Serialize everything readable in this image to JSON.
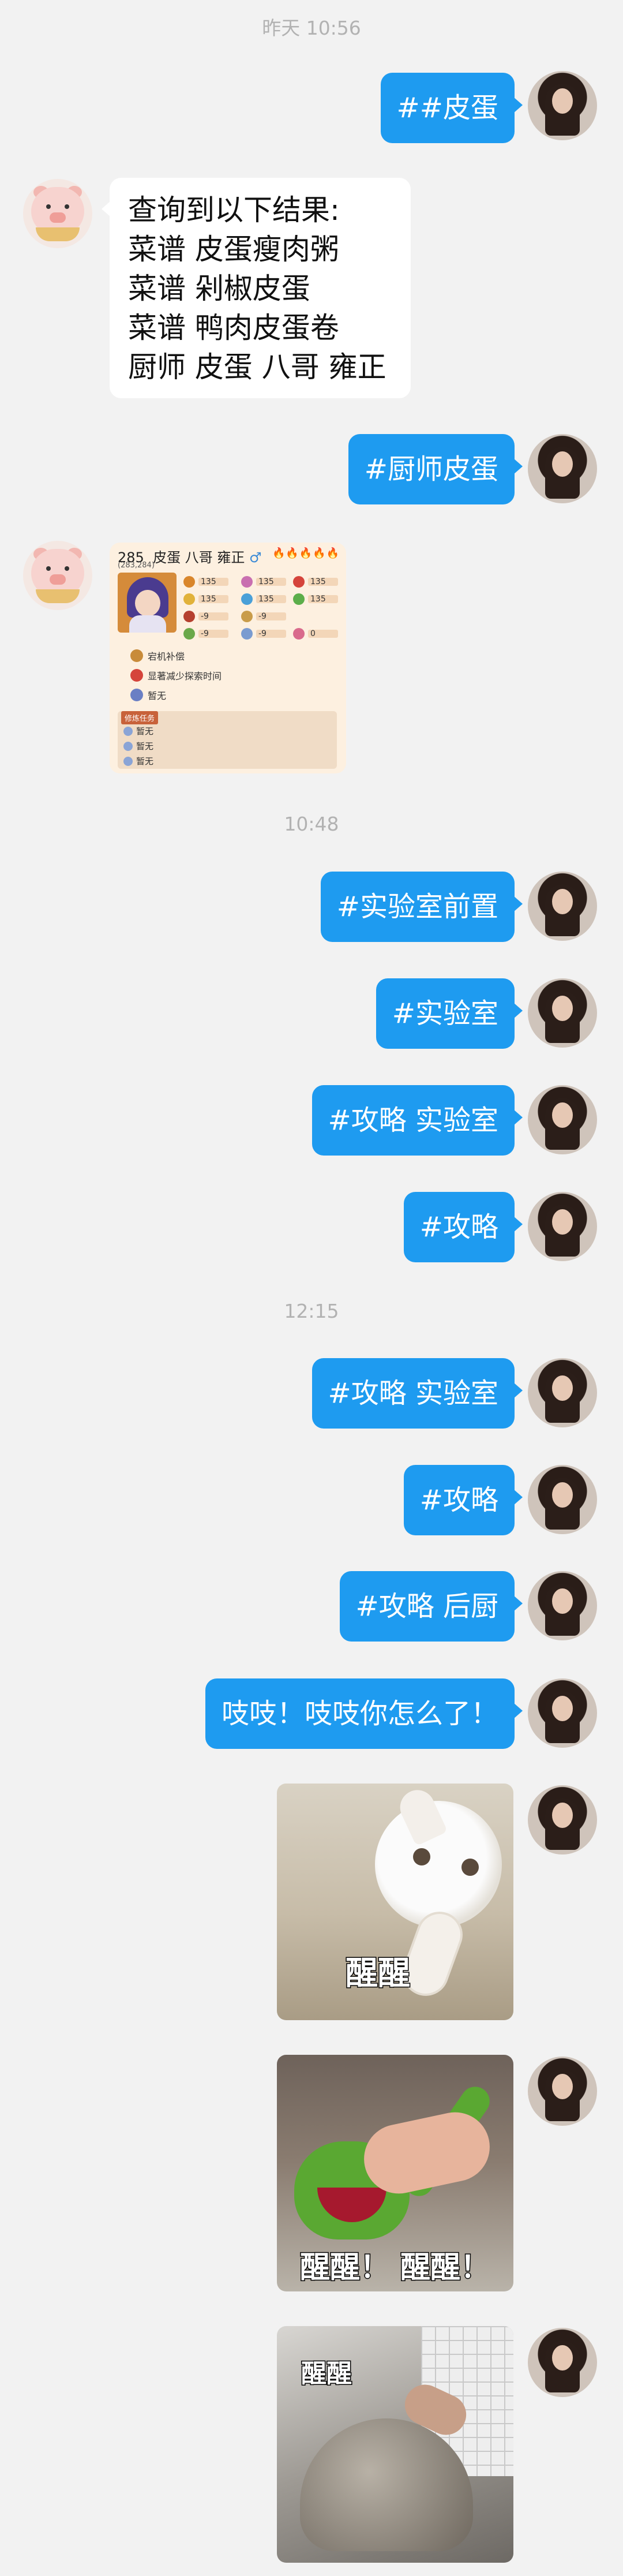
{
  "timestamps": [
    "昨天 10:56",
    "10:48",
    "12:15"
  ],
  "messages": {
    "m1": "##皮蛋",
    "reply": [
      "查询到以下结果:",
      "菜谱 皮蛋瘦肉粥",
      "菜谱 剁椒皮蛋",
      "菜谱 鸭肉皮蛋卷",
      "厨师 皮蛋 八哥 雍正"
    ],
    "m2": "#厨师皮蛋",
    "m3": "#实验室前置",
    "m4": "#实验室",
    "m5": "#攻略 实验室",
    "m6": "#攻略",
    "m7": "#攻略 实验室",
    "m8": "#攻略",
    "m9": "#攻略 后厨",
    "m10": "吱吱！吱吱你怎么了！"
  },
  "chef_card": {
    "rarity": "285",
    "name": "皮蛋 八哥 雍正",
    "gender": "♂",
    "sub": "(283,284)",
    "flames": "🔥🔥🔥🔥🔥",
    "stats": [
      "135",
      "135",
      "135",
      "135",
      "135",
      "135",
      "-9",
      "-9",
      "-9",
      "-9",
      "-9",
      "0"
    ],
    "skills": [
      "宕机补偿",
      "显著减少探索时间",
      "暂无"
    ],
    "section_tag": "修炼任务",
    "section_rows": [
      "暂无",
      "暂无",
      "暂无"
    ],
    "colors": {
      "bg": "#fdf0e0",
      "accent": "#c8623a"
    }
  },
  "stickers": {
    "s1": "醒醒",
    "s2": "醒醒！ 醒醒！",
    "s3": "醒醒"
  },
  "colors": {
    "outgoing_bubble": "#1e9bf0",
    "incoming_bubble": "#ffffff",
    "background": "#f2f2f2",
    "timestamp": "#b2b2b2"
  }
}
